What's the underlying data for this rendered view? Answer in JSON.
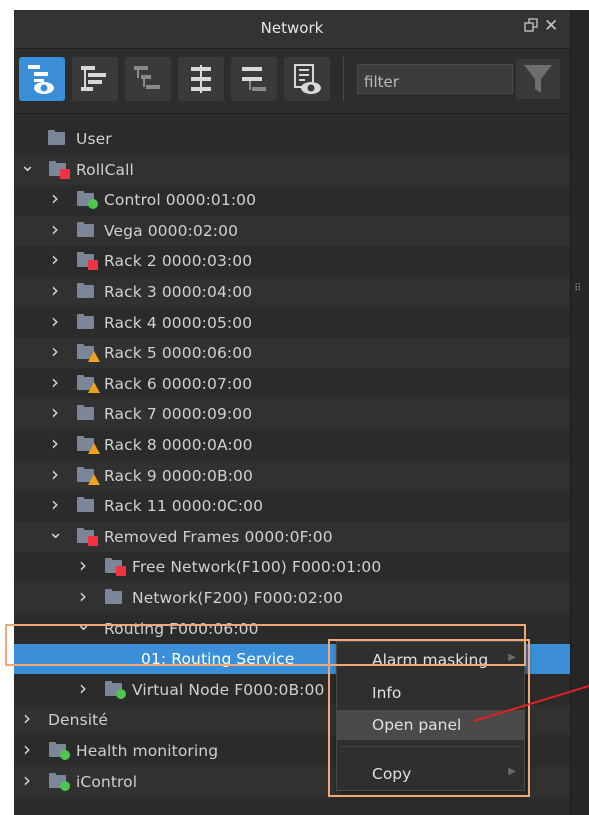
{
  "window": {
    "title": "Network"
  },
  "filter": {
    "placeholder": "filter"
  },
  "toolbar": {
    "buttons": [
      "view-tree-active",
      "expand-tree",
      "collapse-tree",
      "expand-all",
      "collapse-all",
      "alarm-view"
    ]
  },
  "colors": {
    "accent": "#3b8fd9",
    "alarm_red": "#ef3340",
    "ok_green": "#4cc850",
    "warning_orange": "#f0a21c",
    "highlight": "#f0a878",
    "pointer": "#e02020"
  },
  "tree": {
    "rows": [
      {
        "label": "User",
        "status": "none",
        "chevron": "",
        "depth": 0
      },
      {
        "label": "RollCall",
        "status": "red",
        "chevron": "down",
        "depth": 0
      },
      {
        "label": "Control 0000:01:00",
        "status": "green",
        "chevron": "right",
        "depth": 1
      },
      {
        "label": "Vega 0000:02:00",
        "status": "none",
        "chevron": "right",
        "depth": 1
      },
      {
        "label": "Rack 2 0000:03:00",
        "status": "red",
        "chevron": "right",
        "depth": 1
      },
      {
        "label": "Rack 3 0000:04:00",
        "status": "none",
        "chevron": "right",
        "depth": 1
      },
      {
        "label": "Rack 4 0000:05:00",
        "status": "none",
        "chevron": "right",
        "depth": 1
      },
      {
        "label": "Rack 5 0000:06:00",
        "status": "warning",
        "chevron": "right",
        "depth": 1
      },
      {
        "label": "Rack 6 0000:07:00",
        "status": "warning",
        "chevron": "right",
        "depth": 1
      },
      {
        "label": "Rack 7 0000:09:00",
        "status": "none",
        "chevron": "right",
        "depth": 1
      },
      {
        "label": "Rack 8 0000:0A:00",
        "status": "warning",
        "chevron": "right",
        "depth": 1
      },
      {
        "label": "Rack 9 0000:0B:00",
        "status": "warning",
        "chevron": "right",
        "depth": 1
      },
      {
        "label": "Rack 11 0000:0C:00",
        "status": "none",
        "chevron": "right",
        "depth": 1
      },
      {
        "label": "Removed Frames 0000:0F:00",
        "status": "red",
        "chevron": "down",
        "depth": 1
      },
      {
        "label": "Free Network(F100) F000:01:00",
        "status": "red",
        "chevron": "right",
        "depth": 2
      },
      {
        "label": "Network(F200) F000:02:00",
        "status": "none",
        "chevron": "right",
        "depth": 2
      },
      {
        "label": "Routing F000:06:00",
        "status": "none",
        "chevron": "down",
        "depth": 2,
        "noicon": true
      },
      {
        "label": "01: Routing Service",
        "status": "none",
        "chevron": "",
        "depth": 3,
        "noicon": true,
        "selected": true
      },
      {
        "label": "Virtual Node F000:0B:00",
        "status": "green",
        "chevron": "right",
        "depth": 2
      },
      {
        "label": "Densité",
        "status": "none",
        "chevron": "right",
        "depth": 0,
        "noicon": true
      },
      {
        "label": "Health monitoring",
        "status": "green",
        "chevron": "right",
        "depth": 0
      },
      {
        "label": "iControl",
        "status": "green",
        "chevron": "right",
        "depth": 0
      }
    ]
  },
  "context_menu": {
    "items": [
      {
        "label": "Alarm masking",
        "submenu": true
      },
      {
        "label": "Info",
        "submenu": false
      },
      {
        "label": "Open panel",
        "submenu": false,
        "hover": true
      },
      {
        "label": "Copy",
        "submenu": true
      }
    ]
  }
}
